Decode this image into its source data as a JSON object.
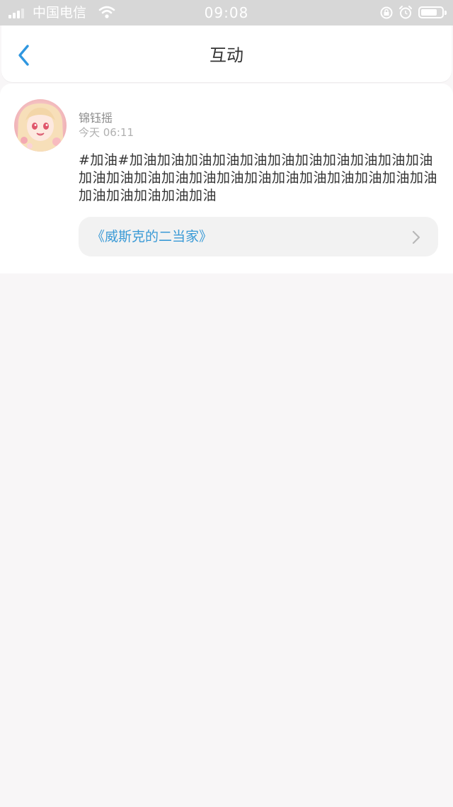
{
  "status_bar": {
    "carrier": "中国电信",
    "time": "09:08",
    "battery_level": 0.8
  },
  "nav": {
    "title": "互动",
    "back_icon": "chevron-left-icon"
  },
  "post": {
    "username": "锦钰摇",
    "timestamp": "今天 06:11",
    "content": "#加油#加油加油加油加油加油加油加油加油加油加油加油加油加油加油加油加油加油加油加油加油加油加油加油加油加油加油加油加油加油",
    "book_link": "《威斯克的二当家》"
  },
  "colors": {
    "accent": "#3a9ad6",
    "background": "#f8f6f7",
    "status_bar": "#d7d7d7"
  }
}
